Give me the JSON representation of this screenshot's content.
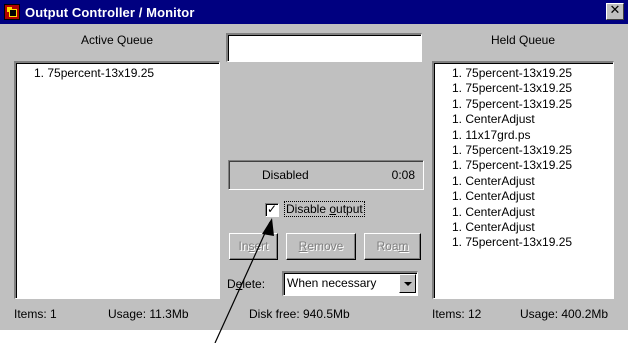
{
  "window": {
    "title": "Output Controller / Monitor",
    "close_label": "✕"
  },
  "active_queue": {
    "header": "Active Queue",
    "items": [
      "1. 75percent-13x19.25"
    ],
    "footer_items": "Items:  1",
    "footer_usage": "Usage: 11.3Mb"
  },
  "center": {
    "name_value": "",
    "status": "Disabled",
    "time": "0:08",
    "disable_checked": true,
    "disable_label_pre": "Disable ",
    "disable_label_ul": "o",
    "disable_label_post": "utput",
    "buttons": {
      "insert_pre": "In",
      "insert_ul": "s",
      "insert_post": "ert",
      "remove_ul": "R",
      "remove_post": "emove",
      "roam_pre": "Roa",
      "roam_ul": "m",
      "roam_post": ""
    },
    "delete_pre": "D",
    "delete_ul": "e",
    "delete_post": "lete:",
    "delete_value": "When necessary",
    "disk_free": "Disk free:  940.5Mb"
  },
  "held_queue": {
    "header": "Held Queue",
    "items": [
      "1. 75percent-13x19.25",
      "1. 75percent-13x19.25",
      "1. 75percent-13x19.25",
      "1. CenterAdjust",
      "1. 11x17grd.ps",
      "1. 75percent-13x19.25",
      "1. 75percent-13x19.25",
      "1. CenterAdjust",
      "1. CenterAdjust",
      "1. CenterAdjust",
      "1. CenterAdjust",
      "1. 75percent-13x19.25"
    ],
    "footer_items": "Items:  12",
    "footer_usage": "Usage: 400.2Mb"
  },
  "colors": {
    "titlebar": "#000080",
    "face": "#c0c0c0",
    "disabled_text": "#808080"
  },
  "icons": [
    "app-icon",
    "close-icon",
    "checkmark-icon",
    "dropdown-arrow-icon",
    "pointer-arrow-icon"
  ]
}
